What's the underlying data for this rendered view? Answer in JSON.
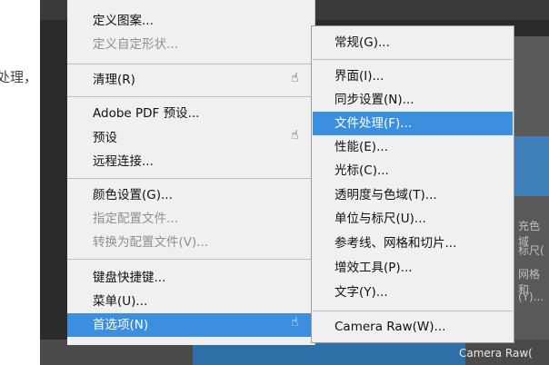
{
  "background": {
    "left_text": "处理，",
    "right_texts": [
      "充色域",
      "标尺(",
      "网格和",
      "(Y)..."
    ],
    "bottom_text": "Camera Raw("
  },
  "main_menu": {
    "items": [
      {
        "label": "定义图案...",
        "disabled": false
      },
      {
        "label": "定义自定形状...",
        "disabled": true
      },
      {
        "label": "清理(R)",
        "disabled": false
      },
      {
        "label": "Adobe PDF 预设...",
        "disabled": false
      },
      {
        "label": "预设",
        "disabled": false
      },
      {
        "label": "远程连接...",
        "disabled": false
      },
      {
        "label": "颜色设置(G)...",
        "disabled": false
      },
      {
        "label": "指定配置文件...",
        "disabled": true
      },
      {
        "label": "转换为配置文件(V)...",
        "disabled": true
      },
      {
        "label": "键盘快捷键...",
        "disabled": false
      },
      {
        "label": "菜单(U)...",
        "disabled": false
      },
      {
        "label": "首选项(N)",
        "disabled": false,
        "active": true
      }
    ]
  },
  "submenu": {
    "items": [
      {
        "label": "常规(G)..."
      },
      {
        "label": "界面(I)..."
      },
      {
        "label": "同步设置(N)..."
      },
      {
        "label": "文件处理(F)...",
        "active": true
      },
      {
        "label": "性能(E)..."
      },
      {
        "label": "光标(C)..."
      },
      {
        "label": "透明度与色域(T)..."
      },
      {
        "label": "单位与标尺(U)..."
      },
      {
        "label": "参考线、网格和切片..."
      },
      {
        "label": "增效工具(P)..."
      },
      {
        "label": "文字(Y)..."
      },
      {
        "label": "Camera Raw(W)..."
      }
    ]
  },
  "colors": {
    "highlight": "#3c8fde",
    "menu_bg": "#f0f0f0",
    "disabled_text": "#8f8f8f"
  },
  "icons": [
    "submenu-arrow-cursor-icon"
  ]
}
